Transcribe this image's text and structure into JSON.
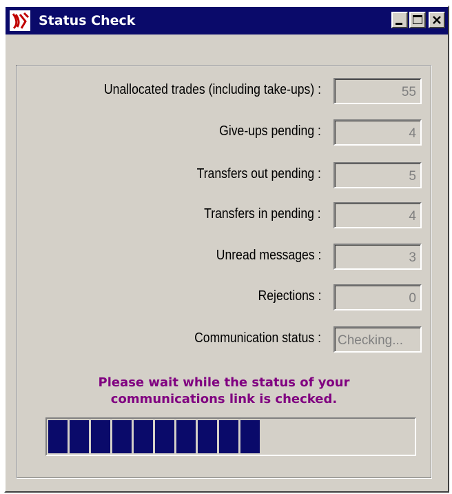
{
  "window": {
    "title": "Status Check"
  },
  "fields": [
    {
      "label": "Unallocated trades (including take-ups) :",
      "value": "55"
    },
    {
      "label": "Give-ups pending :",
      "value": "4"
    },
    {
      "label": "Transfers out pending :",
      "value": "5"
    },
    {
      "label": "Transfers in pending :",
      "value": "4"
    },
    {
      "label": "Unread messages :",
      "value": "3"
    },
    {
      "label": "Rejections :",
      "value": "0"
    },
    {
      "label": "Communication status :",
      "value": "Checking..."
    }
  ],
  "message": {
    "line1": "Please wait while the status of your",
    "line2": "communications link is checked."
  },
  "progress": {
    "fraction": 0.56,
    "segments_filled": 10
  },
  "colors": {
    "titlebar": "#0a0a6a",
    "face": "#d4d0c8",
    "message": "#800080",
    "progress_fill": "#0a0a6a"
  },
  "icons": {
    "app": "app-logo-icon",
    "minimize": "minimize-icon",
    "maximize": "maximize-icon",
    "close": "close-icon"
  }
}
